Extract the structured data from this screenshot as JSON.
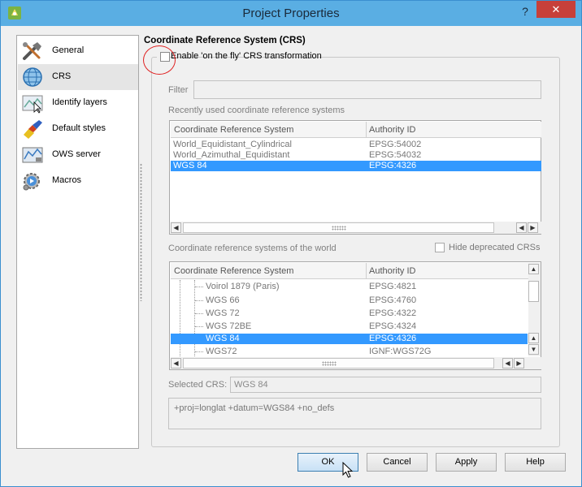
{
  "window": {
    "title": "Project Properties",
    "help": "?",
    "close": "✕"
  },
  "sidebar": {
    "items": [
      {
        "label": "General",
        "icon": "tools-icon"
      },
      {
        "label": "CRS",
        "icon": "globe-icon"
      },
      {
        "label": "Identify layers",
        "icon": "identify-map-icon"
      },
      {
        "label": "Default styles",
        "icon": "paintbrush-icon"
      },
      {
        "label": "OWS server",
        "icon": "ows-map-icon"
      },
      {
        "label": "Macros",
        "icon": "macro-gear-icon"
      }
    ],
    "selected": "CRS"
  },
  "crs": {
    "section_title": "Coordinate Reference System (CRS)",
    "otf_label": "Enable 'on the fly' CRS transformation",
    "otf_checked": false,
    "filter_label": "Filter",
    "filter_value": "",
    "recent_label": "Recently used coordinate reference systems",
    "recent_table": {
      "headers": [
        "Coordinate Reference System",
        "Authority ID"
      ],
      "rows": [
        {
          "name": "World_Equidistant_Cylindrical",
          "id": "EPSG:54002",
          "selected": false
        },
        {
          "name": "World_Azimuthal_Equidistant",
          "id": "EPSG:54032",
          "selected": false
        },
        {
          "name": "WGS 84",
          "id": "EPSG:4326",
          "selected": true
        }
      ]
    },
    "world_label": "Coordinate reference systems of the world",
    "hide_deprecated_label": "Hide deprecated CRSs",
    "world_table": {
      "headers": [
        "Coordinate Reference System",
        "Authority ID"
      ],
      "rows": [
        {
          "name": "Voirol 1879 (Paris)",
          "id": "EPSG:4821",
          "selected": false
        },
        {
          "name": "WGS 66",
          "id": "EPSG:4760",
          "selected": false
        },
        {
          "name": "WGS 72",
          "id": "EPSG:4322",
          "selected": false
        },
        {
          "name": "WGS 72BE",
          "id": "EPSG:4324",
          "selected": false
        },
        {
          "name": "WGS 84",
          "id": "EPSG:4326",
          "selected": true
        },
        {
          "name": "WGS72",
          "id": "IGNF:WGS72G",
          "selected": false
        }
      ]
    },
    "selected_crs_label": "Selected CRS:",
    "selected_crs_value": "WGS 84",
    "proj_string": "+proj=longlat +datum=WGS84 +no_defs"
  },
  "buttons": {
    "ok": "OK",
    "cancel": "Cancel",
    "apply": "Apply",
    "help": "Help"
  },
  "colors": {
    "titlebar": "#5aaee3",
    "selection": "#3399ff",
    "close": "#c7403a",
    "annotation": "#e02020"
  }
}
